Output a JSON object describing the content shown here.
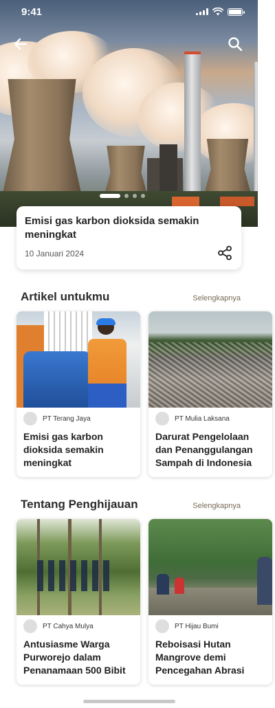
{
  "status_bar": {
    "time": "9:41"
  },
  "hero": {
    "slides": [
      1,
      2,
      3,
      4
    ],
    "active_slide": 1,
    "headline": "Emisi gas karbon dioksida semakin meningkat",
    "date": "10 Januari 2024"
  },
  "sections": [
    {
      "title": "Artikel untukmu",
      "more_label": "Selengkapnya",
      "cards": [
        {
          "publisher": "PT Terang Jaya",
          "title": "Emisi gas karbon dioksida semakin meningkat"
        },
        {
          "publisher": "PT Mulia Laksana",
          "title": "Darurat Pengelolaan dan Penanggulangan Sampah di Indonesia"
        }
      ]
    },
    {
      "title": "Tentang Penghijauan",
      "more_label": "Selengkapnya",
      "cards": [
        {
          "publisher": "PT Cahya Mulya",
          "title": "Antusiasme Warga Purworejo dalam Penanamaan 500 Bibit"
        },
        {
          "publisher": "PT Hijau Bumi",
          "title": "Reboisasi Hutan Mangrove demi Pencegahan Abrasi"
        }
      ]
    }
  ],
  "colors": {
    "accent_link": "#7a6a55",
    "card_shadow": "#000000"
  },
  "icons": [
    "back-arrow-icon",
    "search-icon",
    "share-icon"
  ]
}
